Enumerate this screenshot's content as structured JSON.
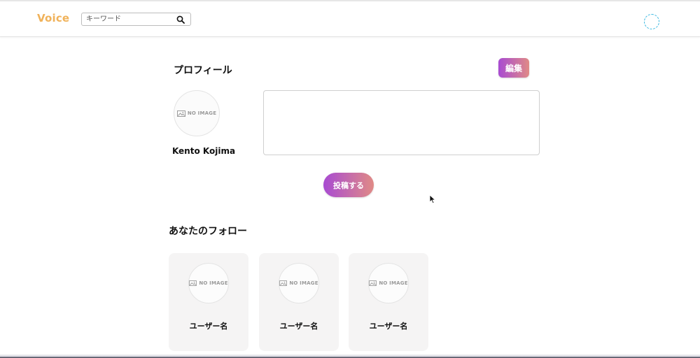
{
  "header": {
    "logo": "Voice",
    "search": {
      "placeholder": "キーワード",
      "value": ""
    },
    "icons": {
      "search": "search-icon",
      "user": "user-avatar-icon"
    },
    "colors": {
      "logo": "#f0b25a",
      "avatar_ring": "#35b6e0"
    }
  },
  "profile": {
    "title": "プロフィール",
    "edit_label": "編集",
    "avatar_text": "NO IMAGE",
    "name": "Kento Kojima",
    "post_placeholder": "",
    "post_label": "投稿する",
    "accent_gradient": [
      "#a84bd2",
      "#e08a86"
    ]
  },
  "follow": {
    "title": "あなたのフォロー",
    "cards": [
      {
        "image_text": "NO IMAGE",
        "name": "ユーザー名"
      },
      {
        "image_text": "NO IMAGE",
        "name": "ユーザー名"
      },
      {
        "image_text": "NO IMAGE",
        "name": "ユーザー名"
      }
    ]
  }
}
